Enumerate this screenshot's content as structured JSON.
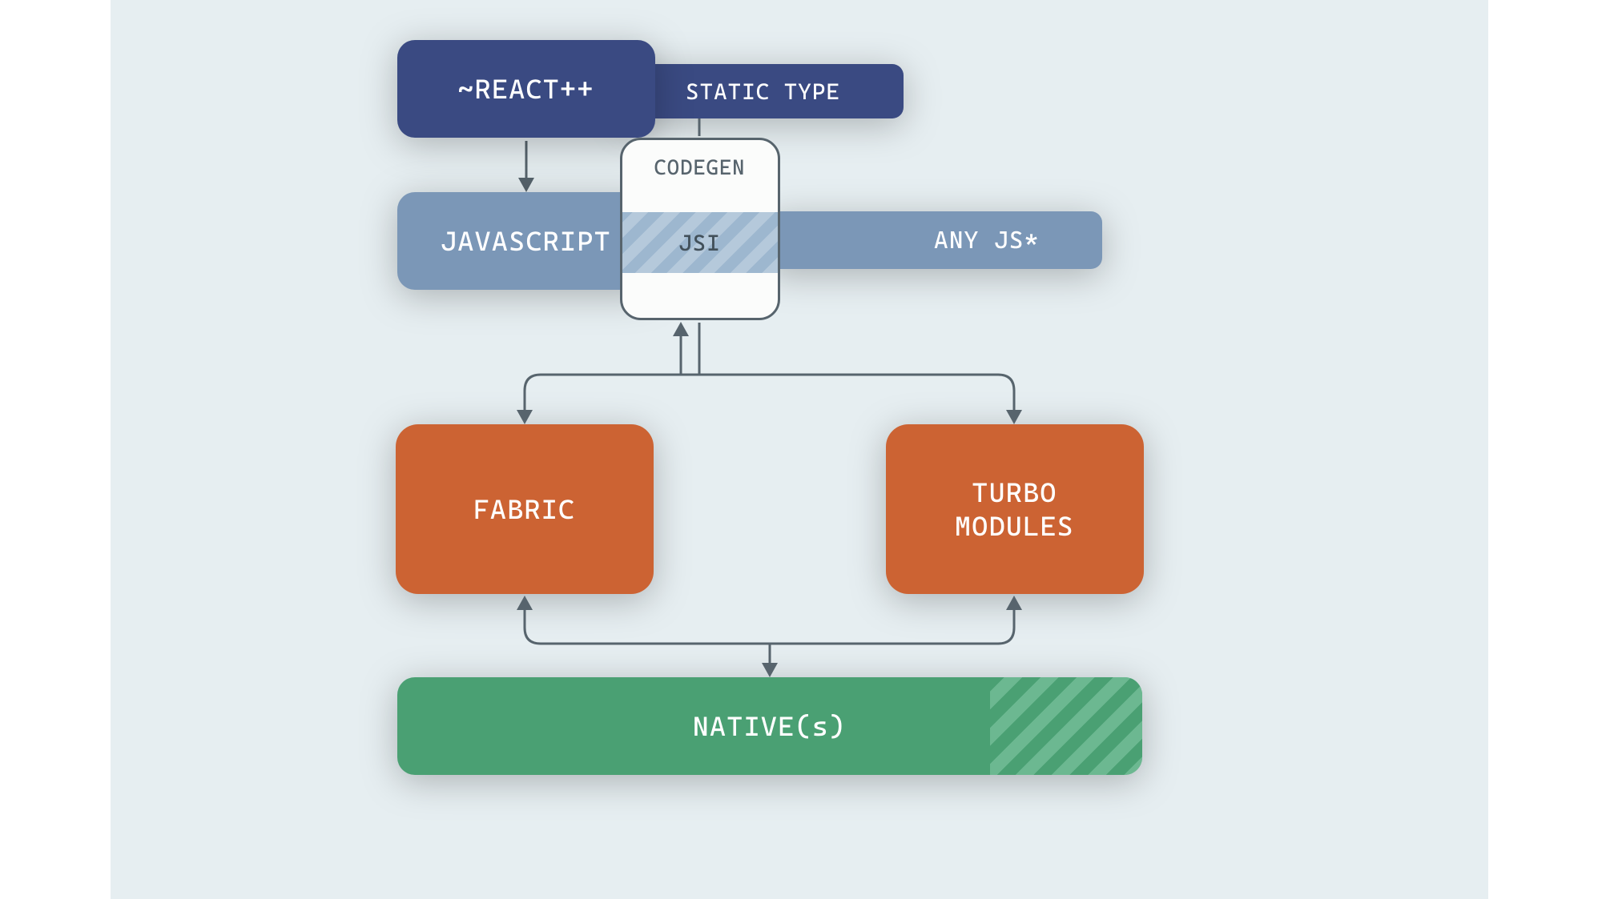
{
  "diagram": {
    "nodes": {
      "react_pp": "~REACT++",
      "static_type": "STATIC TYPE",
      "javascript": "JAVASCRIPT",
      "any_js": "ANY JS*",
      "codegen": "CODEGEN",
      "jsi": "JSI",
      "fabric": "FABRIC",
      "turbo_modules": "TURBO\nMODULES",
      "native": "NATIVE(s)"
    },
    "colors": {
      "darkblue": "#3a4a82",
      "midblue": "#7b97b7",
      "orange": "#cc6333",
      "green": "#4aa073",
      "outline": "#57646d",
      "panel_bg": "#e6eef1"
    }
  }
}
